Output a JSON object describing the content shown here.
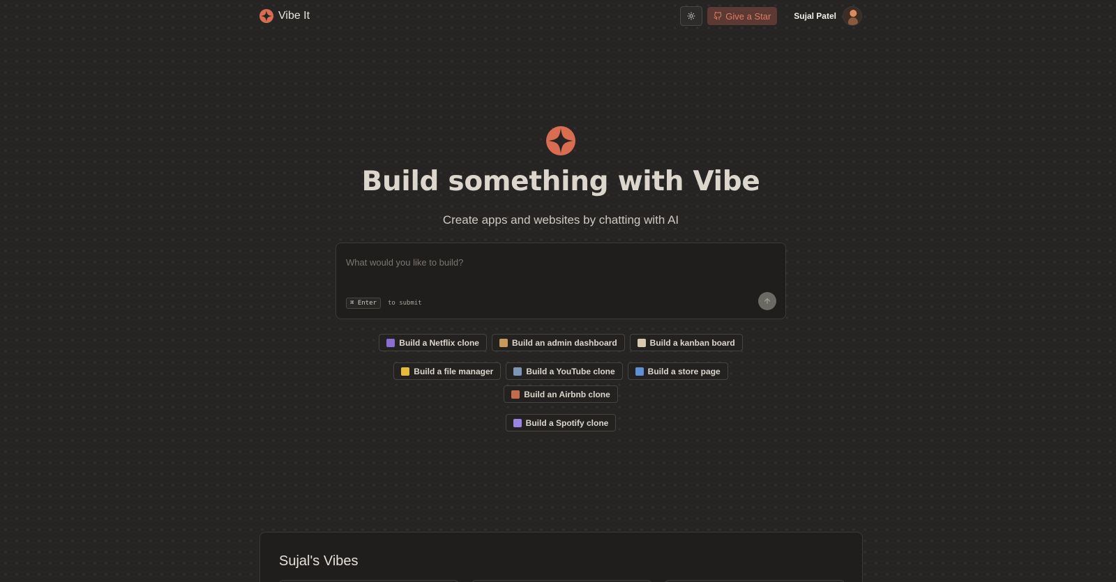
{
  "header": {
    "brand_name": "Vibe It",
    "theme_icon": "sun-icon",
    "star_icon": "github-icon",
    "star_label": "Give a Star",
    "user_name": "Sujal Patel"
  },
  "hero": {
    "title": "Build something with Vibe",
    "subtitle": "Create apps and websites by chatting with AI"
  },
  "prompt": {
    "placeholder": "What would you like to build?",
    "value": "",
    "kbd_label": "⌘ Enter",
    "hint": "to submit",
    "submit_icon": "arrow-up-icon"
  },
  "suggestions": [
    {
      "emoji": "clapper-board",
      "color": "#8a6fd1",
      "label": "Build a Netflix clone"
    },
    {
      "emoji": "package",
      "color": "#c89a5b",
      "label": "Build an admin dashboard"
    },
    {
      "emoji": "clipboard",
      "color": "#d9c9b0",
      "label": "Build a kanban board"
    },
    {
      "emoji": "file-folder",
      "color": "#e8b93a",
      "label": "Build a file manager"
    },
    {
      "emoji": "television",
      "color": "#7e95b8",
      "label": "Build a YouTube clone"
    },
    {
      "emoji": "shopping-bags",
      "color": "#5f8fd6",
      "label": "Build a store page"
    },
    {
      "emoji": "house",
      "color": "#c56b4a",
      "label": "Build an Airbnb clone"
    },
    {
      "emoji": "musical-note",
      "color": "#9a86e0",
      "label": "Build a Spotify clone"
    }
  ],
  "vibes": {
    "title": "Sujal's Vibes"
  },
  "colors": {
    "background": "#262524",
    "accent": "#e07a63",
    "accent_bg": "#5a3a33",
    "panel": "#1f1e1d"
  }
}
